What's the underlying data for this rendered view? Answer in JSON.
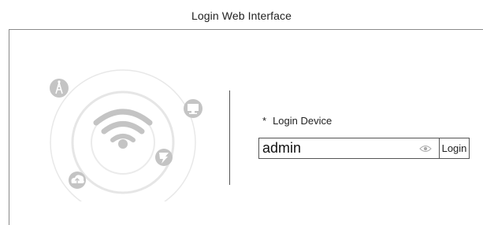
{
  "header": {
    "title": "Login Web Interface"
  },
  "illustration": {
    "center_icon": "wifi-icon",
    "satellite_icons": [
      "antenna-icon",
      "monitor-icon",
      "fan-icon",
      "cloud-upload-icon"
    ],
    "ring_color": "#e6e6e6",
    "icon_color": "#c4c4c4"
  },
  "login": {
    "required_marker": "*",
    "device_label": "Login Device",
    "device_value": "admin",
    "visibility_icon": "eye-icon",
    "button_label": "Login"
  }
}
